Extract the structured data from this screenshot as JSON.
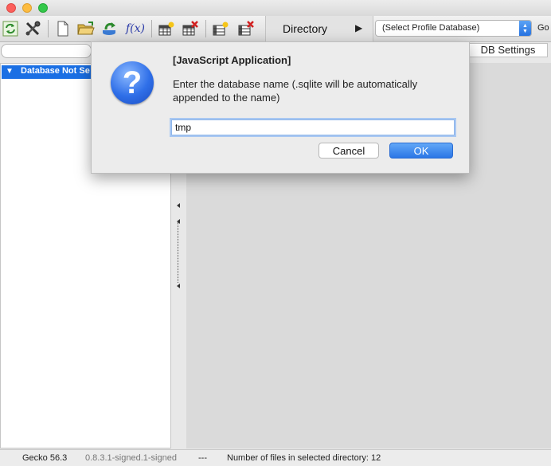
{
  "toolbar": {
    "fx_label": "f(x)",
    "directory_label": "Directory",
    "profile_select_value": "(Select Profile Database)",
    "go_label": "Go"
  },
  "db_settings_label": "DB Settings",
  "tree": {
    "selected_label": "Database Not Se"
  },
  "dialog": {
    "title": "[JavaScript Application]",
    "message": "Enter the database name (.sqlite will be automatically appended to the name)",
    "input_value": "tmp",
    "cancel_label": "Cancel",
    "ok_label": "OK"
  },
  "status": {
    "engine": "Gecko 56.3",
    "version": "0.8.3.1-signed.1-signed",
    "separator": "---",
    "files_info": "Number of files in selected directory: 12"
  },
  "colors": {
    "selection": "#1a6fe4",
    "ok_button": "#2b76e6",
    "close": "#fc605c",
    "minimize": "#fdbc40",
    "maximize": "#34c84a"
  }
}
